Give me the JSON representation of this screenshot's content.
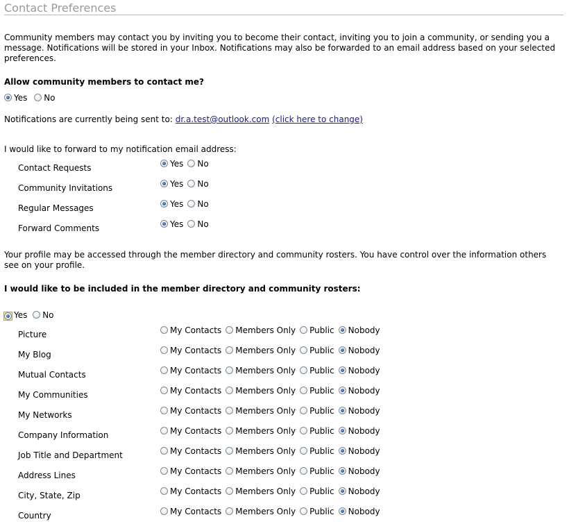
{
  "page": {
    "title": "Contact Preferences",
    "intro": "Community members may contact you by inviting you to become their contact, inviting you to join a community, or sending you a message. Notifications will be stored in your Inbox. Notifications may also be forwarded to an email address based on your selected preferences."
  },
  "allow_contact": {
    "heading": "Allow community members to contact me?",
    "yes_label": "Yes",
    "no_label": "No",
    "selected": "Yes"
  },
  "notifications": {
    "prefix": "Notifications are currently being sent to:",
    "email": "dr.a.test@outlook.com",
    "change_link": "(click here to change)"
  },
  "forward": {
    "intro": "I would like to forward to my notification email address:",
    "yes_label": "Yes",
    "no_label": "No",
    "rows": [
      {
        "label": "Contact Requests",
        "selected": "Yes"
      },
      {
        "label": "Community Invitations",
        "selected": "Yes"
      },
      {
        "label": "Regular Messages",
        "selected": "Yes"
      },
      {
        "label": "Forward Comments",
        "selected": "Yes"
      }
    ]
  },
  "profile": {
    "intro": "Your profile may be accessed through the member directory and community rosters. You have control over the information others see on your profile."
  },
  "directory": {
    "heading": "I would like to be included in the member directory and community rosters:",
    "yes_label": "Yes",
    "no_label": "No",
    "selected": "Yes",
    "options": [
      "My Contacts",
      "Members Only",
      "Public",
      "Nobody"
    ],
    "rows": [
      {
        "label": "Picture",
        "selected": "Nobody"
      },
      {
        "label": "My Blog",
        "selected": "Nobody"
      },
      {
        "label": "Mutual Contacts",
        "selected": "Nobody"
      },
      {
        "label": "My Communities",
        "selected": "Nobody"
      },
      {
        "label": "My Networks",
        "selected": "Nobody"
      },
      {
        "label": "Company Information",
        "selected": "Nobody"
      },
      {
        "label": "Job Title and Department",
        "selected": "Nobody"
      },
      {
        "label": "Address Lines",
        "selected": "Nobody"
      },
      {
        "label": "City, State, Zip",
        "selected": "Nobody"
      },
      {
        "label": "Country",
        "selected": "Nobody"
      }
    ]
  }
}
